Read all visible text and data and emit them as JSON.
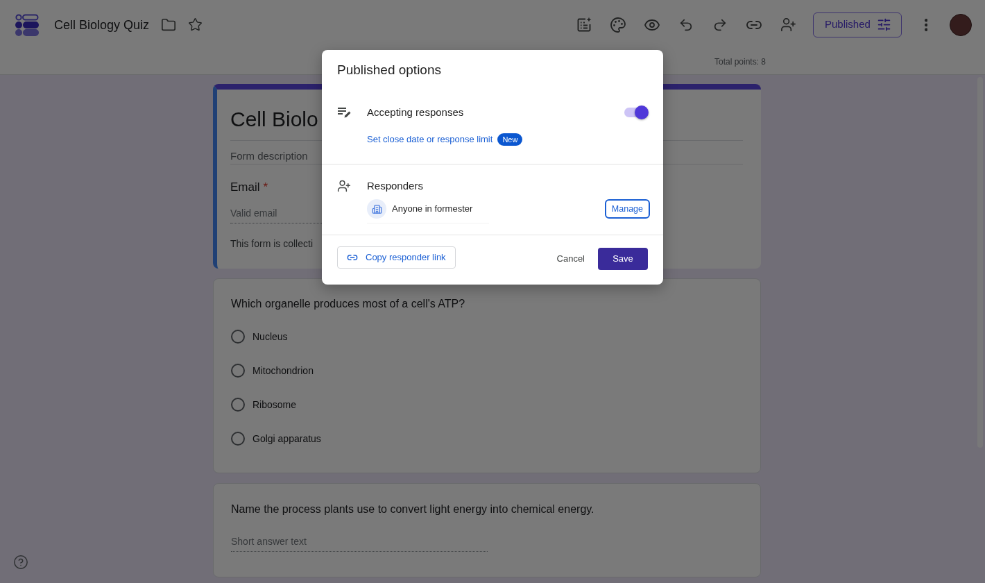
{
  "app_bar": {
    "title": "Cell Biology Quiz",
    "publish_button": "Published"
  },
  "total_points": "Total points: 8",
  "form": {
    "active": true,
    "title": "Cell Biolo",
    "description": {
      "placeholder": "Form description"
    },
    "email_field": {
      "label": "Email",
      "required_mark": "*",
      "placeholder": "Valid email"
    },
    "collecting_note": "This form is collecti"
  },
  "questions": [
    {
      "kind": "multiple_choice",
      "text": "Which organelle produces most of a cell's ATP?",
      "options": [
        {
          "label": "Nucleus",
          "selected": false
        },
        {
          "label": "Mitochondrion",
          "selected": false
        },
        {
          "label": "Ribosome",
          "selected": false
        },
        {
          "label": "Golgi apparatus",
          "selected": false
        }
      ]
    },
    {
      "kind": "short_answer",
      "text": "Name the process plants use to convert light energy into chemical energy.",
      "placeholder": "Short answer text"
    }
  ],
  "dialog": {
    "title": "Published options",
    "accepting_responses": {
      "label": "Accepting responses",
      "on": true,
      "link": "Set close date or response limit",
      "badge": "New"
    },
    "responders": {
      "label": "Responders",
      "audience": "Anyone in formester",
      "manage_button": "Manage"
    },
    "copy_link_button": "Copy responder link",
    "cancel_button": "Cancel",
    "save_button": "Save"
  }
}
